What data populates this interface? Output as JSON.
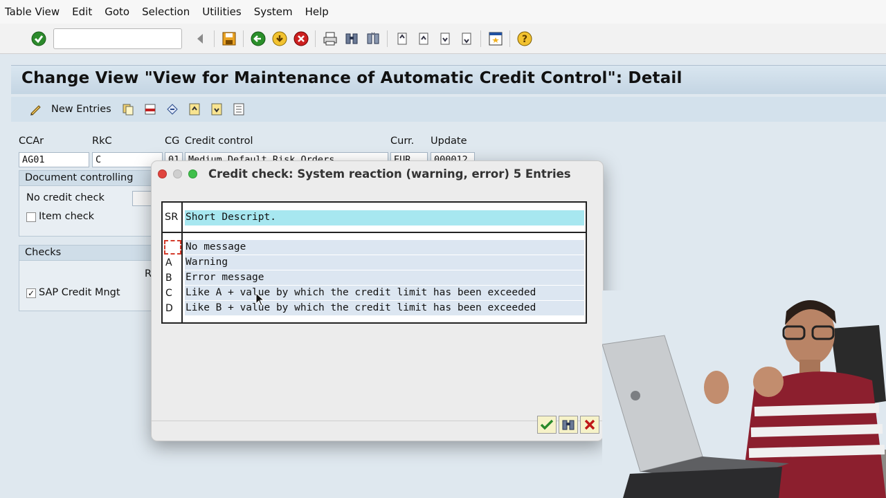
{
  "menu": [
    "Table View",
    "Edit",
    "Goto",
    "Selection",
    "Utilities",
    "System",
    "Help"
  ],
  "toolbar": {
    "command_field_value": "",
    "icons": [
      "enter-icon",
      "back-arrow-icon",
      "save-icon",
      "back-icon",
      "exit-icon",
      "cancel-icon",
      "print-icon",
      "find-icon",
      "find-next-icon",
      "first-page-icon",
      "previous-page-icon",
      "next-page-icon",
      "last-page-icon",
      "layout-icon",
      "help-icon"
    ]
  },
  "title": "Change View \"View for Maintenance of Automatic Credit Control\": Detail",
  "app_toolbar": {
    "new_entries": "New Entries"
  },
  "header_fields": {
    "labels": {
      "ccar": "CCAr",
      "rkc": "RkC",
      "cg": "CG",
      "credit_control": "Credit control",
      "curr": "Curr.",
      "update": "Update"
    },
    "values": {
      "ccar": "AG01",
      "rkc": "C",
      "cg": "01",
      "credit_control": "Medium Default Risk Orders",
      "curr": "EUR",
      "update": "000012"
    }
  },
  "document_controlling": {
    "title": "Document controlling",
    "no_credit_check": "No credit check",
    "item_check": "Item check",
    "item_check_checked": false
  },
  "checks": {
    "title": "Checks",
    "column_fragment": "R",
    "sap_credit_mngt": "SAP Credit Mngt",
    "sap_credit_mngt_checked": true
  },
  "dialog": {
    "title": "Credit check: System reaction (warning, error) 5 Entries",
    "col_key": "SR",
    "col_desc": "Short Descript.",
    "rows": [
      {
        "key": "",
        "desc": "No message"
      },
      {
        "key": "A",
        "desc": "Warning"
      },
      {
        "key": "B",
        "desc": "Error message"
      },
      {
        "key": "C",
        "desc": "Like A + value by which the credit limit has been exceeded"
      },
      {
        "key": "D",
        "desc": "Like B + value by which the credit limit has been exceeded"
      }
    ]
  },
  "colors": {
    "menu_bg": "#f7f7f7",
    "title_band": "#c4d5e3",
    "header_cell": "#a7e7f0",
    "row_cell": "#dce6f1",
    "close_light": "#e0443e",
    "min_light": "#cfcfcf",
    "zoom_light": "#3fbf4a"
  }
}
